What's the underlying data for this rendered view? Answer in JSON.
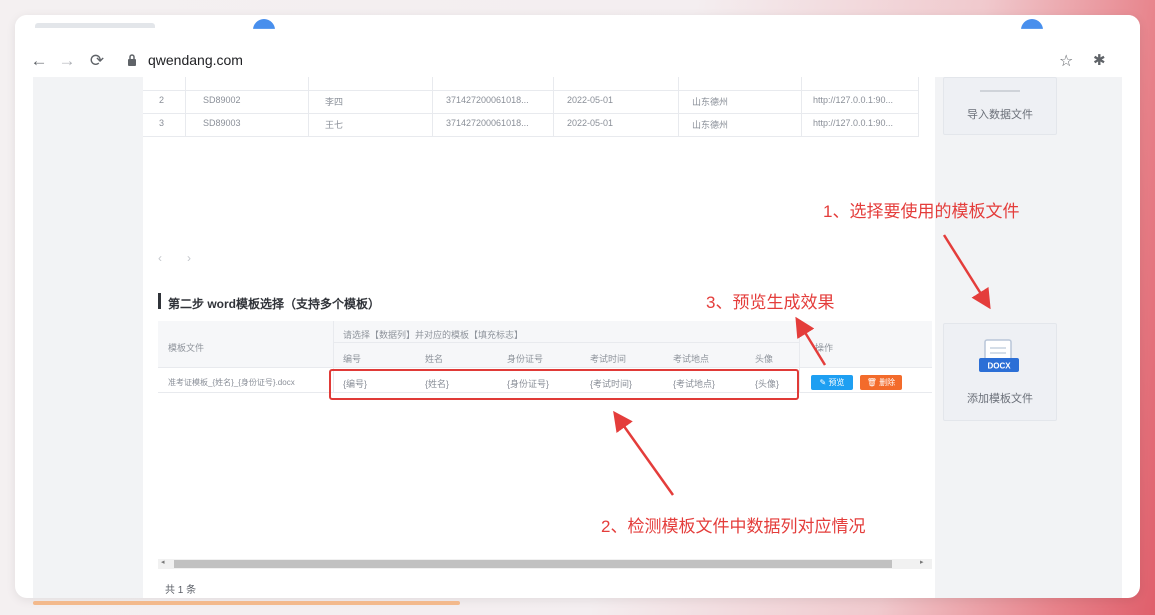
{
  "browser": {
    "url": "qwendang.com"
  },
  "data_table": {
    "rows": [
      {
        "no": "2",
        "id": "SD89002",
        "name": "李四",
        "idcard": "37142720006101​8...",
        "date": "2022-05-01",
        "place": "山东德州",
        "link": "http://127.0.0.1:90..."
      },
      {
        "no": "3",
        "id": "SD89003",
        "name": "王七",
        "idcard": "37142720006101​8...",
        "date": "2022-05-01",
        "place": "山东德州",
        "link": "http://127.0.0.1:90..."
      }
    ],
    "pager_prev": "‹",
    "pager_next": "›"
  },
  "side": {
    "import_label": "导入数据文件",
    "add_template_label": "添加模板文件",
    "docx_badge": "DOCX"
  },
  "step2": {
    "title": "第二步 word模板选择（支持多个模板）",
    "col_template": "模板文件",
    "hint": "请选择【数据列】并对应的模板【填充标志】",
    "col_action": "操作",
    "subheaders": [
      "编号",
      "姓名",
      "身份证号",
      "考试时间",
      "考试地点",
      "头像"
    ],
    "row_template": "准考证模板_{姓名}_{身份证号}.docx",
    "row_values": [
      "{编号}",
      "{姓名}",
      "{身份证号}",
      "{考试时间}",
      "{考试地点}",
      "{头像}"
    ],
    "preview_btn": "✎ 预览",
    "delete_btn": "🗑 删除",
    "footer": "共 1 条"
  },
  "annotations": {
    "a1": "1、选择要使用的模板文件",
    "a2": "2、检测模板文件中数据列对应情况",
    "a3": "3、预览生成效果"
  },
  "colors": {
    "annotation_red": "#e43d3b",
    "preview_blue": "#1e9ff2",
    "delete_orange": "#f36b2b"
  }
}
